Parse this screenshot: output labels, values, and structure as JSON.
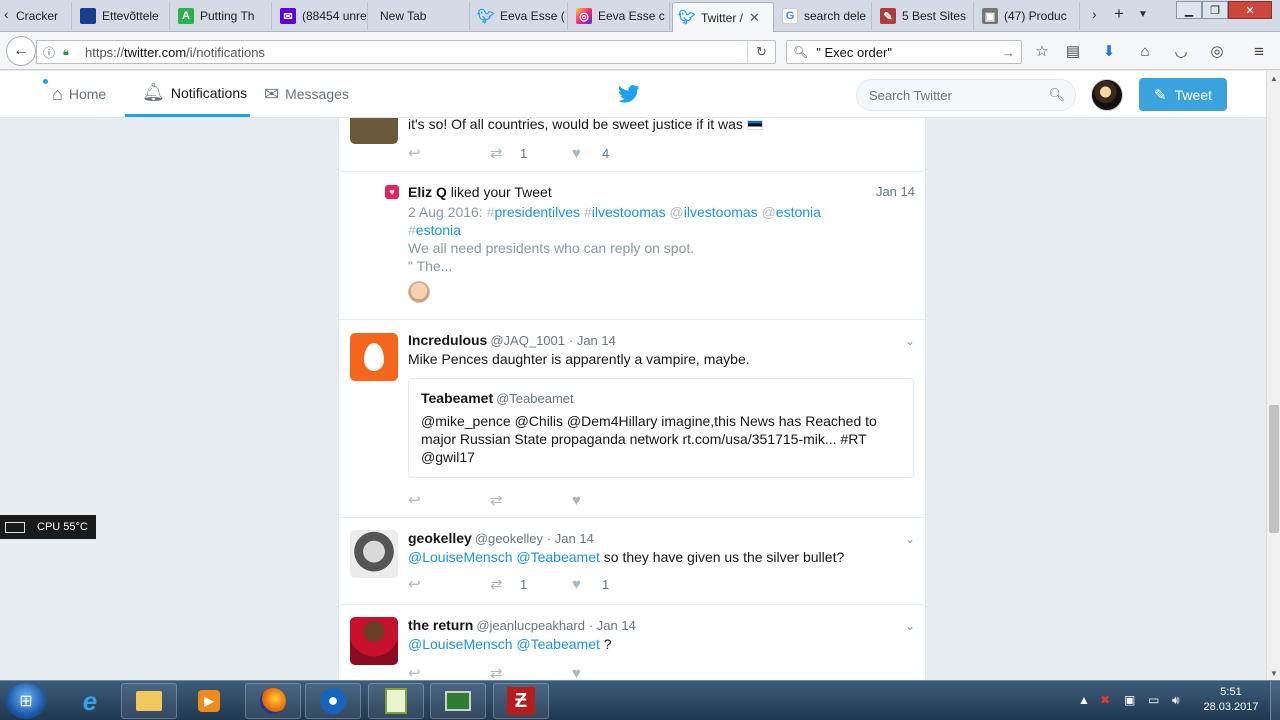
{
  "browser": {
    "tabs": [
      {
        "label": "Cracker",
        "icon": "generic-page-icon"
      },
      {
        "label": "Ettevõttele",
        "icon": "company-site-icon"
      },
      {
        "label": "Putting Th",
        "icon": "green-a-icon"
      },
      {
        "label": "(88454 unre",
        "icon": "yahoo-mail-icon"
      },
      {
        "label": "New Tab",
        "icon": "none"
      },
      {
        "label": "Eeva Esse (",
        "icon": "twitter-bird-icon"
      },
      {
        "label": "Eeva Esse c",
        "icon": "instagram-icon"
      },
      {
        "label": "Twitter /",
        "icon": "twitter-bird-icon",
        "active": true
      },
      {
        "label": "search dele",
        "icon": "google-icon"
      },
      {
        "label": "5 Best Sites",
        "icon": "tag-icon"
      },
      {
        "label": "(47) Produc",
        "icon": "generic-page-icon"
      }
    ],
    "url_prefix": "https://",
    "url_host": "twitter.com",
    "url_path": "/i/notifications",
    "search_value": "\" Exec order\""
  },
  "twitter": {
    "nav": {
      "home": "Home",
      "notifications": "Notifications",
      "messages": "Messages"
    },
    "search_placeholder": "Search Twitter",
    "tweet_button": "Tweet",
    "accent": "#1da1f2"
  },
  "feed": {
    "partial": {
      "text": "it's so! Of all countries, would be sweet justice if it was",
      "retweets": "1",
      "likes": "4"
    },
    "like_notification": {
      "name": "Eliz Q",
      "action": "liked your Tweet",
      "time": "Jan 14",
      "line1_date": "2 Aug 2016:",
      "tag1": "presidentilves",
      "tag2": "ilvestoomas",
      "mention1": "ilvestoomas",
      "mention2": "estonia",
      "tag3": "estonia",
      "line3": "We all need presidents who can reply on spot.",
      "line4": "\" The..."
    },
    "tweet1": {
      "name": "Incredulous",
      "handle": "@JAQ_1001",
      "time": "· Jan 14",
      "text": "Mike Pences daughter is apparently a vampire, maybe.",
      "quote": {
        "name": "Teabeamet",
        "handle": "@Teabeamet",
        "text": "@mike_pence @Chilis @Dem4Hillary imagine,this News has Reached to major Russian State propaganda network rt.com/usa/351715-mik... #RT @gwil17"
      }
    },
    "tweet2": {
      "name": "geokelley",
      "handle": "@geokelley",
      "time": "· Jan 14",
      "mention1": "@LouiseMensch",
      "mention2": "@Teabeamet",
      "text": "so they have given us the silver bullet?",
      "retweets": "1",
      "likes": "1"
    },
    "tweet3": {
      "name": "the return",
      "handle": "@jeanlucpeakhard",
      "time": "· Jan 14",
      "mention1": "@LouiseMensch",
      "mention2": "@Teabeamet",
      "text": "?"
    }
  },
  "gadget": {
    "cpu": "CPU 55°C"
  },
  "taskbar": {
    "time": "5:51",
    "date": "28.03.2017"
  }
}
